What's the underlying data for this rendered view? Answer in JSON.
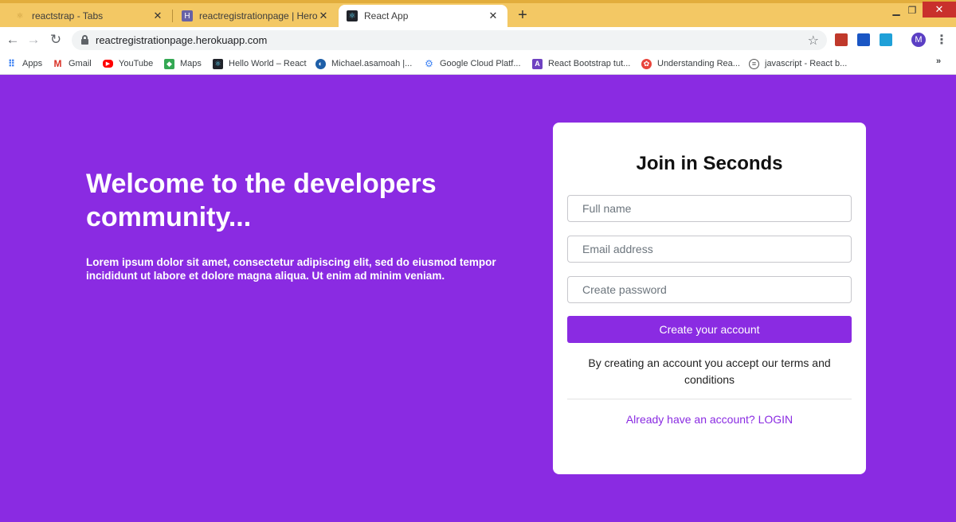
{
  "browser": {
    "tabs": [
      {
        "title": "reactstrap - Tabs",
        "active": false
      },
      {
        "title": "reactregistrationpage | Heroku",
        "active": false
      },
      {
        "title": "React App",
        "active": true
      }
    ],
    "url": "reactregistrationpage.herokuapp.com",
    "profile_initial": "M",
    "bookmarks": [
      "Apps",
      "Gmail",
      "YouTube",
      "Maps",
      "Hello World – React",
      "Michael.asamoah |...",
      "Google Cloud Platf...",
      "React Bootstrap tut...",
      "Understanding Rea...",
      "javascript - React b..."
    ],
    "bookmarks_overflow": "»"
  },
  "hero": {
    "title": "Welcome to the developers community...",
    "text": "Lorem ipsum dolor sit amet, consectetur adipiscing elit, sed do eiusmod tempor incididunt ut labore et dolore magna aliqua. Ut enim ad minim veniam."
  },
  "form": {
    "title": "Join in Seconds",
    "fullname_placeholder": "Full name",
    "email_placeholder": "Email address",
    "password_placeholder": "Create password",
    "submit_label": "Create your account",
    "terms_text": "By creating an account you accept our terms and conditions",
    "login_link": "Already have an account? LOGIN"
  },
  "colors": {
    "brand_purple": "#8a2be2",
    "tabstrip": "#f3c864"
  }
}
